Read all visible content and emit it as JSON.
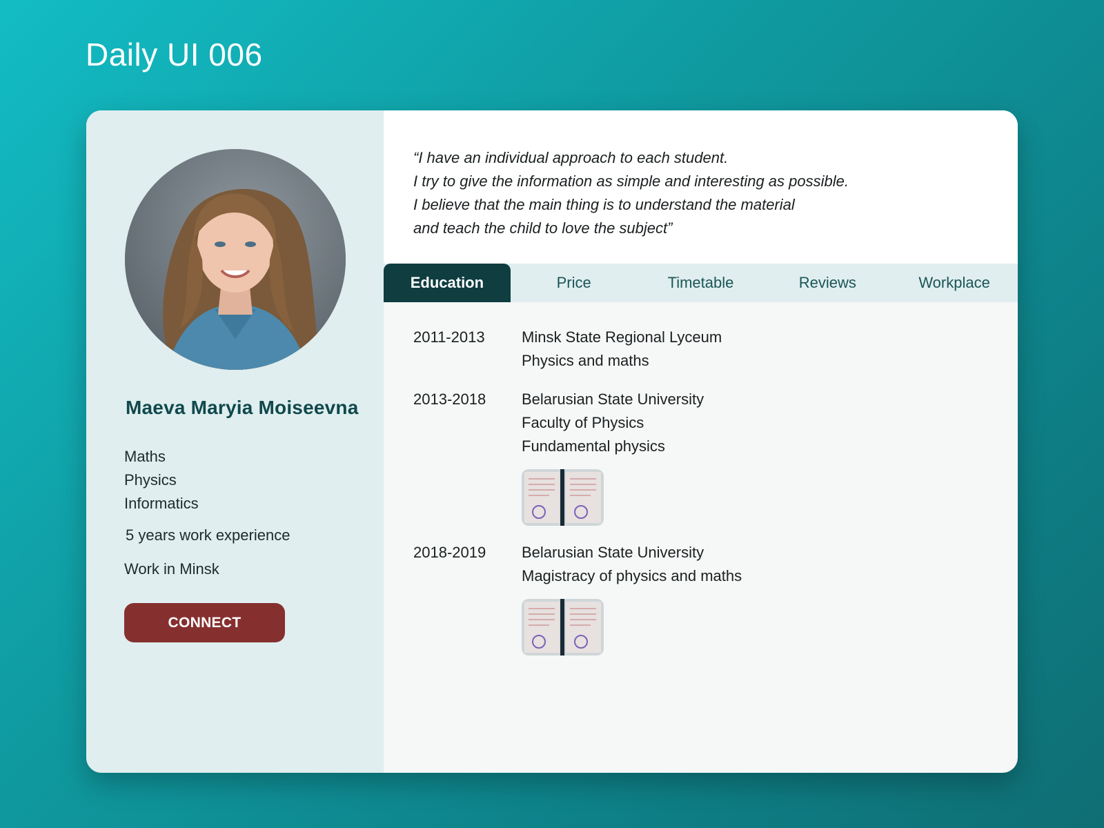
{
  "page": {
    "title": "Daily UI 006"
  },
  "profile": {
    "name": "Maeva Maryia Moiseevna",
    "subjects": [
      "Maths",
      "Physics",
      "Informatics"
    ],
    "experience": "5 years work experience",
    "location": "Work in Minsk",
    "connect_label": "CONNECT"
  },
  "quote": {
    "lines": [
      "“I have an individual approach to each student.",
      "I try to give the information as simple and interesting as possible.",
      "I believe that the main thing is to understand the material",
      "and teach the child to love the subject”"
    ]
  },
  "tabs": [
    {
      "label": "Education",
      "active": true
    },
    {
      "label": "Price",
      "active": false
    },
    {
      "label": "Timetable",
      "active": false
    },
    {
      "label": "Reviews",
      "active": false
    },
    {
      "label": "Workplace",
      "active": false
    }
  ],
  "education": [
    {
      "years": "2011-2013",
      "lines": [
        "Minsk State Regional Lyceum",
        "Physics and maths"
      ],
      "has_diploma": false
    },
    {
      "years": "2013-2018",
      "lines": [
        "Belarusian State University",
        "Faculty of Physics",
        "Fundamental physics"
      ],
      "has_diploma": true
    },
    {
      "years": "2018-2019",
      "lines": [
        "Belarusian State University",
        "Magistracy of physics and maths"
      ],
      "has_diploma": true
    }
  ],
  "colors": {
    "background": "#109ea5",
    "sidebar": "#e0eeef",
    "name_text": "#10484b",
    "connect_button": "#862f2f",
    "active_tab": "#0f3d40",
    "tab_text": "#1b5557"
  },
  "icons": {
    "avatar": "profile-photo",
    "diploma": "diploma-thumbnail"
  }
}
